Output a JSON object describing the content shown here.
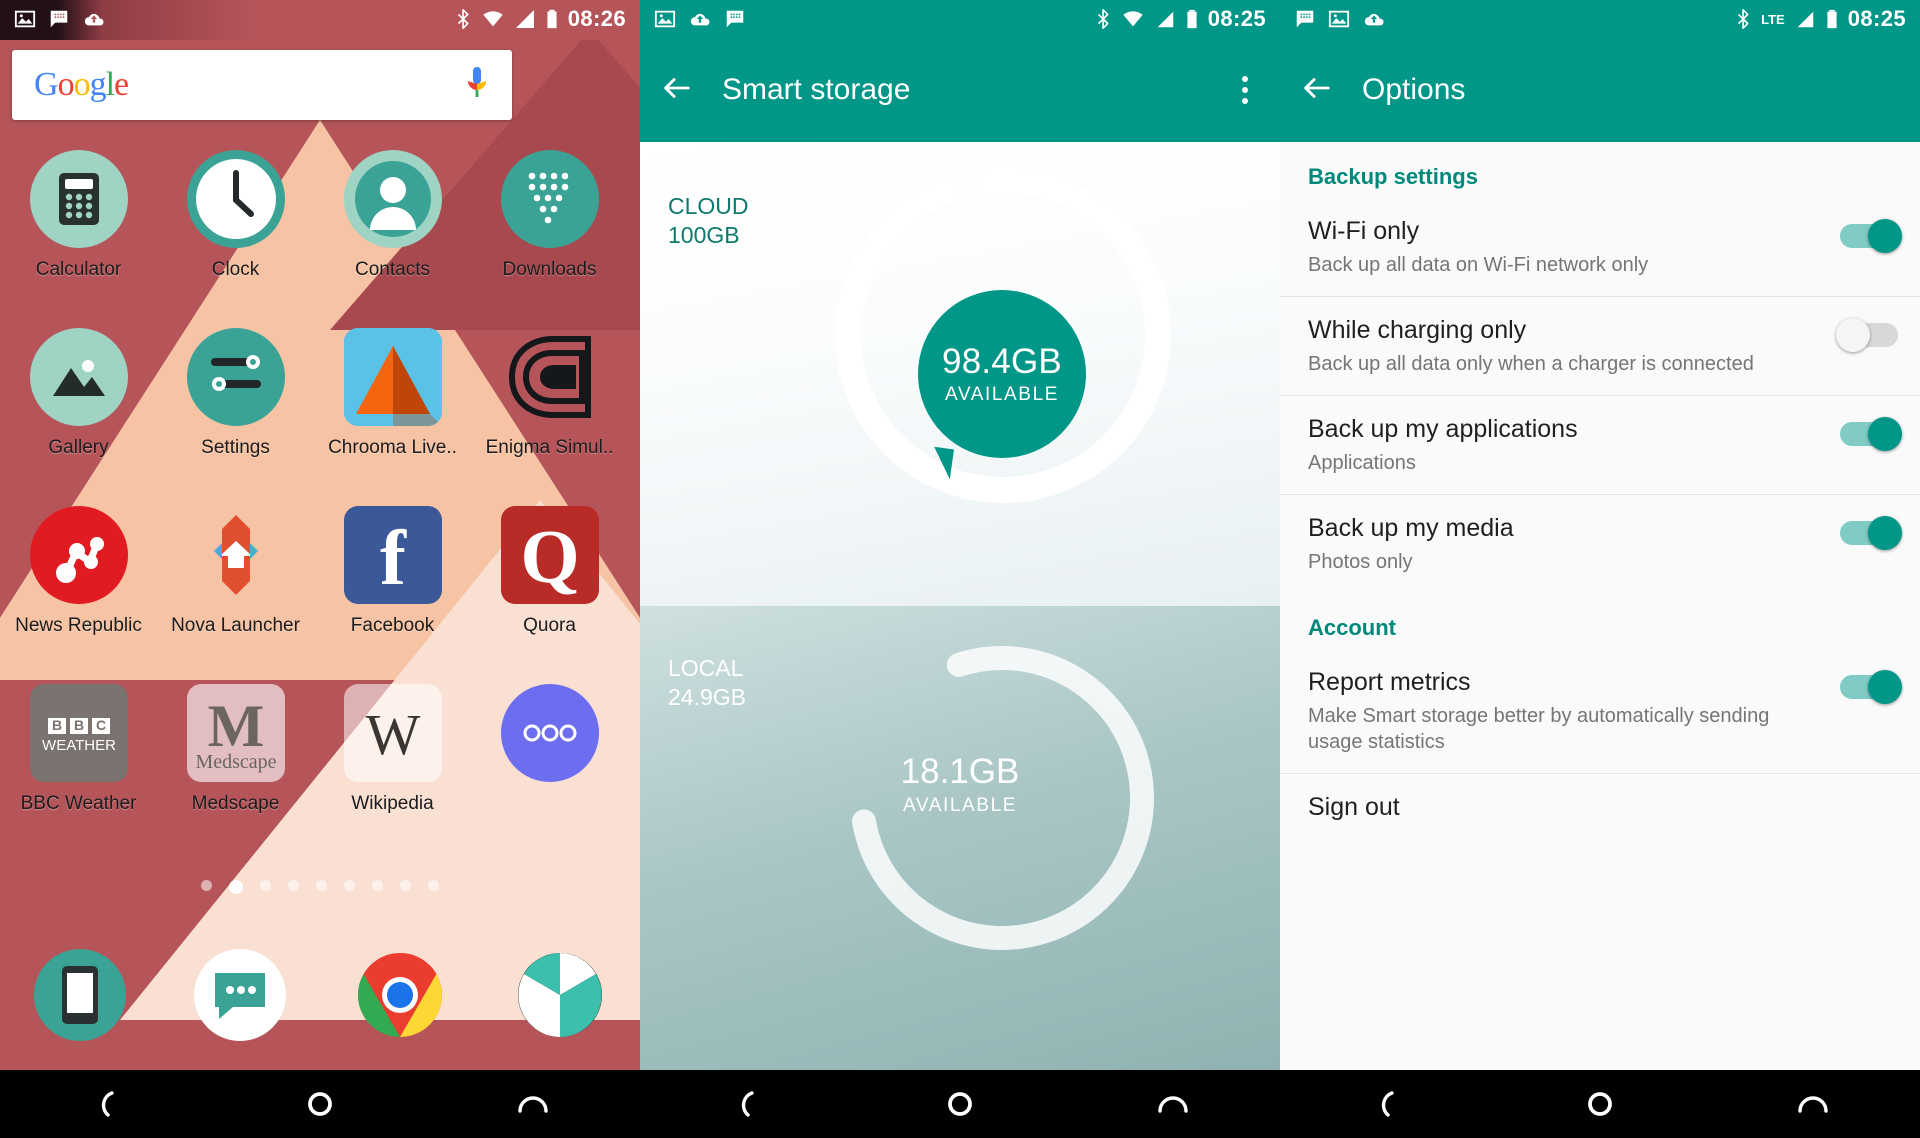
{
  "panels": {
    "home": {
      "status": {
        "time": "08:26",
        "left_icons": [
          "image-icon",
          "bbm-message-icon",
          "cloud-upload-icon"
        ],
        "right_icons": [
          "bluetooth-icon",
          "wifi-icon",
          "signal-icon",
          "battery-icon"
        ]
      },
      "search": {
        "logo": "Google",
        "voice_icon": "microphone-icon"
      },
      "apps": [
        [
          {
            "label": "Calculator",
            "icon": "calculator-icon"
          },
          {
            "label": "Clock",
            "icon": "clock-icon"
          },
          {
            "label": "Contacts",
            "icon": "contacts-icon"
          },
          {
            "label": "Downloads",
            "icon": "downloads-icon"
          }
        ],
        [
          {
            "label": "Gallery",
            "icon": "gallery-icon"
          },
          {
            "label": "Settings",
            "icon": "settings-icon"
          },
          {
            "label": "Chrooma Live..",
            "icon": "chrooma-icon"
          },
          {
            "label": "Enigma Simul..",
            "icon": "enigma-icon"
          }
        ],
        [
          {
            "label": "News Republic",
            "icon": "news-republic-icon"
          },
          {
            "label": "Nova Launcher",
            "icon": "nova-launcher-icon"
          },
          {
            "label": "Facebook",
            "icon": "facebook-icon"
          },
          {
            "label": "Quora",
            "icon": "quora-icon"
          }
        ],
        [
          {
            "label": "BBC Weather",
            "icon": "bbc-weather-icon"
          },
          {
            "label": "Medscape",
            "icon": "medscape-icon"
          },
          {
            "label": "Wikipedia",
            "icon": "wikipedia-icon"
          },
          {
            "label": "",
            "icon": "app-drawer-icon"
          }
        ]
      ],
      "pages": {
        "count": 9,
        "active_index": 1
      },
      "dock": [
        {
          "icon": "phone-icon"
        },
        {
          "icon": "messaging-icon"
        },
        {
          "icon": "chrome-icon"
        },
        {
          "icon": "camera-icon"
        }
      ],
      "navbar": [
        "back-icon",
        "home-icon",
        "recents-icon"
      ]
    },
    "storage": {
      "status": {
        "time": "08:25",
        "left_icons": [
          "image-icon",
          "cloud-upload-icon",
          "bbm-message-icon"
        ],
        "right_icons": [
          "bluetooth-icon",
          "wifi-icon",
          "signal-icon",
          "battery-icon"
        ]
      },
      "appbar": {
        "back_icon": "arrow-left-icon",
        "title": "Smart storage",
        "overflow_icon": "overflow-menu-icon"
      },
      "cloud": {
        "label": "CLOUD",
        "total": "100GB",
        "available_value": "98.4GB",
        "available_caption": "AVAILABLE"
      },
      "local": {
        "label": "LOCAL",
        "total": "24.9GB",
        "available_value": "18.1GB",
        "available_caption": "AVAILABLE"
      },
      "navbar": [
        "back-icon",
        "home-icon",
        "recents-icon"
      ]
    },
    "options": {
      "status": {
        "time": "08:25",
        "left_icons": [
          "bbm-message-icon",
          "image-icon",
          "cloud-upload-icon"
        ],
        "right_icons": [
          "bluetooth-icon",
          "lte-icon",
          "signal-icon",
          "battery-icon"
        ],
        "lte_label": "LTE"
      },
      "appbar": {
        "back_icon": "arrow-left-icon",
        "title": "Options"
      },
      "sections": [
        {
          "header": "Backup settings",
          "rows": [
            {
              "title": "Wi-Fi only",
              "sub": "Back up all data on Wi-Fi network only",
              "toggle": "on"
            },
            {
              "title": "While charging only",
              "sub": "Back up all data only when a charger is connected",
              "toggle": "off"
            },
            {
              "title": "Back up my applications",
              "sub": "Applications",
              "toggle": "on"
            },
            {
              "title": "Back up my media",
              "sub": "Photos only",
              "toggle": "on"
            }
          ]
        },
        {
          "header": "Account",
          "rows": [
            {
              "title": "Report metrics",
              "sub": "Make Smart storage better by automatically sending usage statistics",
              "toggle": "on"
            },
            {
              "title": "Sign out",
              "sub": "",
              "toggle": "none"
            }
          ]
        }
      ],
      "navbar": [
        "back-icon",
        "home-icon",
        "recents-icon"
      ]
    }
  },
  "colors": {
    "teal": "#009688",
    "teal_dark": "#00897b",
    "wallpaper_red": "#b5555a",
    "wallpaper_peach": "#f6c3a4"
  }
}
